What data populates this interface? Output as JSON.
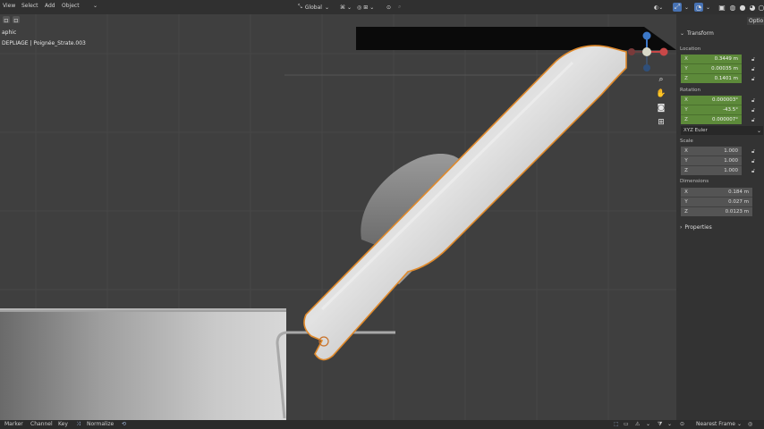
{
  "header": {
    "menus": [
      "View",
      "Select",
      "Add",
      "Object"
    ],
    "transform_orientation": "Global",
    "right_tab": "Optio"
  },
  "viewport": {
    "overlay_line1": "aphic",
    "overlay_line2": "DEPLIAGE | Poignée_Strate.003",
    "gizmo_axes": [
      "x",
      "y",
      "z"
    ]
  },
  "npanel": {
    "transform_title": "Transform",
    "location_label": "Location",
    "location": [
      {
        "axis": "X",
        "value": "0.3449 m"
      },
      {
        "axis": "Y",
        "value": "0.00035 m"
      },
      {
        "axis": "Z",
        "value": "0.1401 m"
      }
    ],
    "rotation_label": "Rotation",
    "rotation": [
      {
        "axis": "X",
        "value": "0.000003°"
      },
      {
        "axis": "Y",
        "value": "-43.5°"
      },
      {
        "axis": "Z",
        "value": "0.000007°"
      }
    ],
    "rotation_mode": "XYZ Euler",
    "scale_label": "Scale",
    "scale": [
      {
        "axis": "X",
        "value": "1.000"
      },
      {
        "axis": "Y",
        "value": "1.000"
      },
      {
        "axis": "Z",
        "value": "1.000"
      }
    ],
    "dimensions_label": "Dimensions",
    "dimensions": [
      {
        "axis": "X",
        "value": "0.184 m"
      },
      {
        "axis": "Y",
        "value": "0.027 m"
      },
      {
        "axis": "Z",
        "value": "0.0123 m"
      }
    ],
    "properties_label": "Properties"
  },
  "footer": {
    "menus": [
      "Marker",
      "Channel",
      "Key"
    ],
    "normalize": "Normalize",
    "interpolation": "Nearest Frame"
  },
  "colors": {
    "accent_green": "#5d8a3a",
    "selection_outline": "#e08a2c",
    "gizmo_x": "#c84848",
    "gizmo_y": "#6aa03c",
    "gizmo_z": "#3c78c8"
  }
}
